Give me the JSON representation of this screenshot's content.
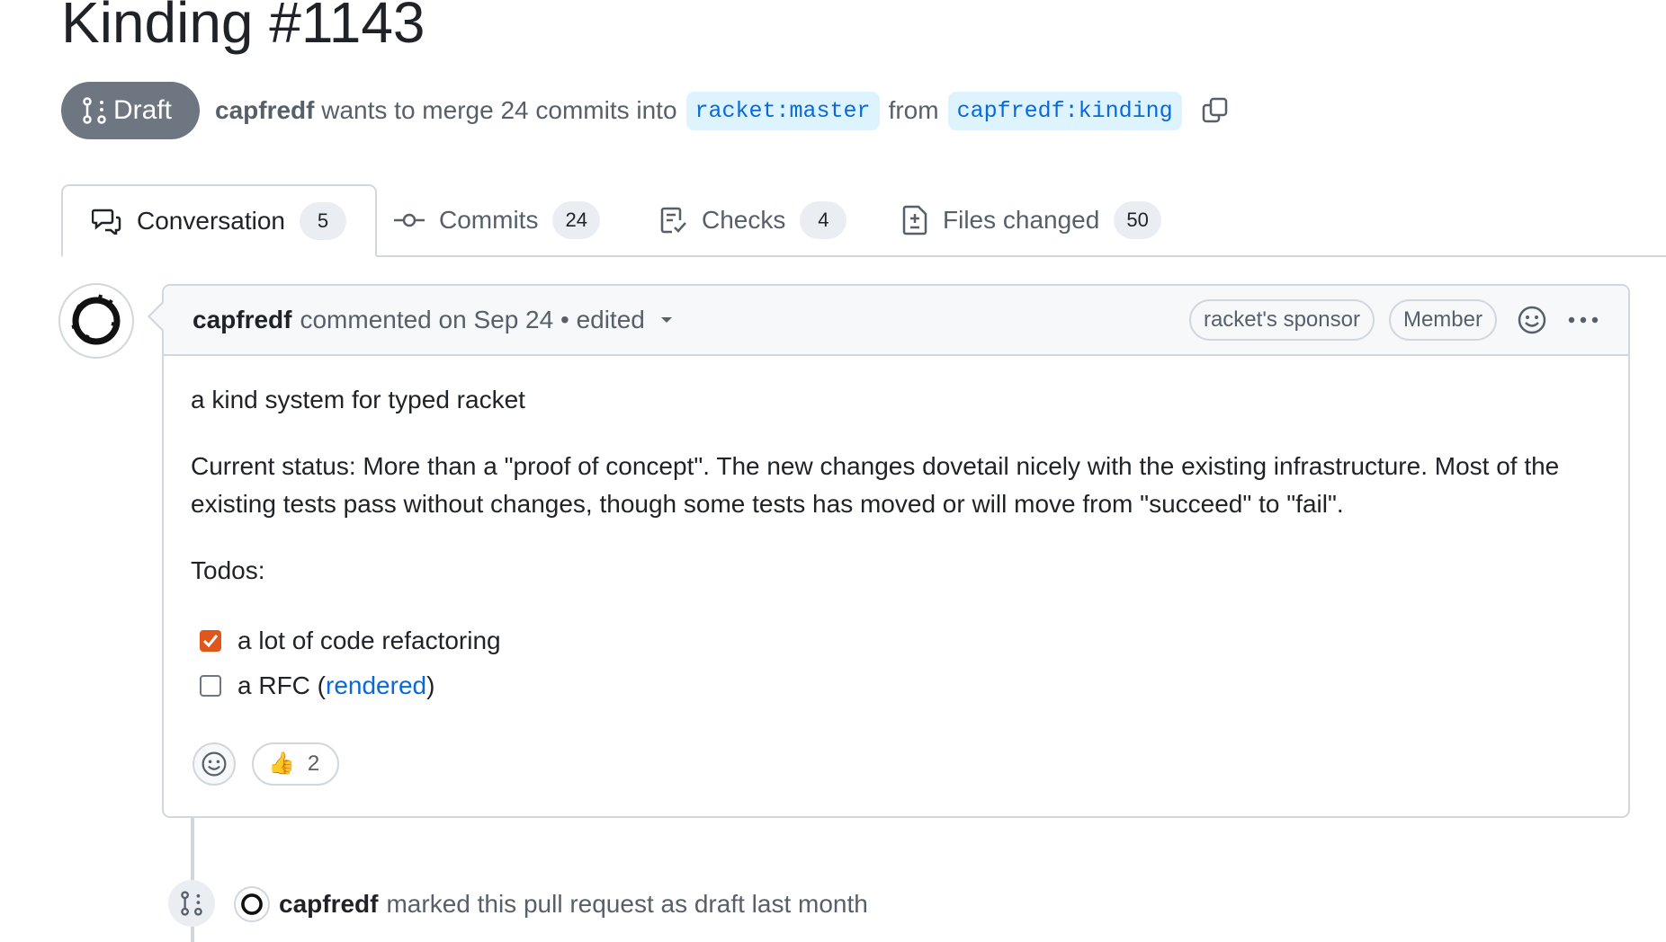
{
  "pr": {
    "title": "Kinding #1143",
    "state": "Draft",
    "author": "capfredf",
    "merge_text": "wants to merge 24 commits into",
    "base_branch": "racket:master",
    "from_text": "from",
    "head_branch": "capfredf:kinding"
  },
  "tabs": [
    {
      "label": "Conversation",
      "count": "5",
      "icon": "conversation-icon"
    },
    {
      "label": "Commits",
      "count": "24",
      "icon": "commit-icon"
    },
    {
      "label": "Checks",
      "count": "4",
      "icon": "checklist-icon"
    },
    {
      "label": "Files changed",
      "count": "50",
      "icon": "file-diff-icon"
    }
  ],
  "comment": {
    "author": "capfredf",
    "meta": "commented on Sep 24 • edited",
    "badges": [
      "racket's sponsor",
      "Member"
    ],
    "body": {
      "intro": "a kind system for typed racket",
      "status": "Current status: More than a \"proof of concept\". The new changes dovetail nicely with the existing infrastructure. Most of the existing tests pass without changes, though some tests has moved or will move from \"succeed\" to \"fail\".",
      "todos_label": "Todos:",
      "tasks": [
        {
          "text": "a lot of code refactoring",
          "checked": true
        },
        {
          "text_before": "a RFC (",
          "link": "rendered",
          "text_after": ")",
          "checked": false
        }
      ]
    },
    "reactions": [
      {
        "emoji": "👍",
        "count": "2"
      }
    ]
  },
  "timeline_event": {
    "author": "capfredf",
    "text": "marked this pull request as draft last month"
  },
  "colors": {
    "draft_badge": "#6e7781",
    "link": "#0969da",
    "branch_bg": "#ddf4ff",
    "checkbox_checked": "#e0571d"
  }
}
